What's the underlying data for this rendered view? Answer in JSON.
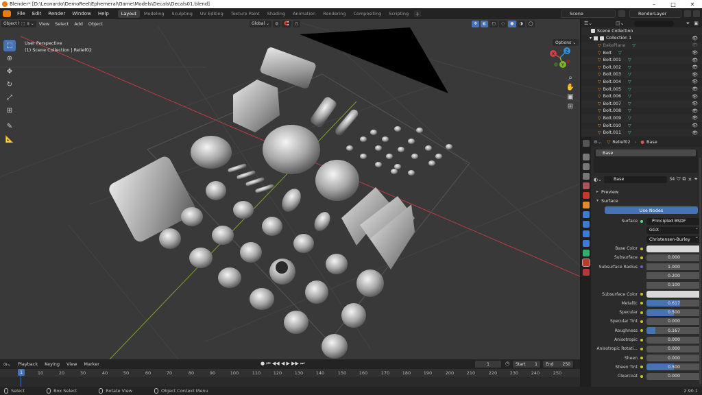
{
  "window": {
    "title": "Blender* [D:\\Leonardo\\DemoReel\\Ephemeral\\Game\\Models\\Decals\\Decals01.blend]",
    "controls": [
      "–",
      "□",
      "✕"
    ]
  },
  "topbar": {
    "menus": [
      "File",
      "Edit",
      "Render",
      "Window",
      "Help"
    ],
    "workspaces": [
      "Layout",
      "Modeling",
      "Sculpting",
      "UV Editing",
      "Texture Paint",
      "Shading",
      "Animation",
      "Rendering",
      "Compositing",
      "Scripting"
    ],
    "active_workspace": "Layout",
    "add_tab": "+",
    "scene": "Scene",
    "view_layer": "RenderLayer"
  },
  "viewport": {
    "mode": "Object Mode",
    "menus": [
      "View",
      "Select",
      "Add",
      "Object"
    ],
    "orientation": "Global",
    "options": "Options",
    "info_line1": "User Perspective",
    "info_line2": "(1) Scene Collection | Relief02",
    "tools": [
      "select-box",
      "cursor",
      "move",
      "rotate",
      "scale",
      "transform",
      "annotate",
      "measure"
    ],
    "gizmo_axes": [
      "X",
      "Y",
      "Z"
    ]
  },
  "timeline": {
    "menus": [
      "Playback",
      "Keying",
      "View",
      "Marker"
    ],
    "current_frame": "1",
    "start_label": "Start",
    "start": "1",
    "end_label": "End",
    "end": "250",
    "ruler": [
      "0",
      "10",
      "20",
      "30",
      "40",
      "50",
      "60",
      "70",
      "80",
      "90",
      "100",
      "110",
      "120",
      "130",
      "140",
      "150",
      "160",
      "170",
      "180",
      "190",
      "200",
      "210",
      "220",
      "230",
      "240",
      "250"
    ],
    "playhead": "1"
  },
  "statusbar": {
    "select": "Select",
    "box_select": "Box Select",
    "rotate_view": "Rotate View",
    "context_menu": "Object Context Menu",
    "version": "2.90.1"
  },
  "outliner": {
    "root": "Scene Collection",
    "collection": "Collection 1",
    "items": [
      "BakePlane",
      "Bolt",
      "Bolt.001",
      "Bolt.002",
      "Bolt.003",
      "Bolt.004",
      "Bolt.005",
      "Bolt.006",
      "Bolt.007",
      "Bolt.008",
      "Bolt.009",
      "Bolt.010",
      "Bolt.011"
    ]
  },
  "properties": {
    "breadcrumb_object": "Relief02",
    "breadcrumb_material": "Base",
    "slot": "Base",
    "material_name": "Base",
    "material_users": "34",
    "sections": {
      "preview": "Preview",
      "surface": "Surface"
    },
    "use_nodes": "Use Nodes",
    "surface_label": "Surface",
    "surface_value": "Principled BSDF",
    "distribution": "GGX",
    "subsurface_method": "Christensen-Burley",
    "rows": [
      {
        "label": "Base Color",
        "value": "",
        "kind": "color"
      },
      {
        "label": "Subsurface",
        "value": "0.000",
        "kind": "num",
        "fill": 0
      },
      {
        "label": "Subsurface Radius",
        "value": "1.000",
        "kind": "vec"
      },
      {
        "label": "",
        "value": "0.200",
        "kind": "vec"
      },
      {
        "label": "",
        "value": "0.100",
        "kind": "vec"
      },
      {
        "label": "Subsurface Color",
        "value": "",
        "kind": "color"
      },
      {
        "label": "Metallic",
        "value": "0.617",
        "kind": "num",
        "fill": 0.617
      },
      {
        "label": "Specular",
        "value": "0.500",
        "kind": "num",
        "fill": 0.5
      },
      {
        "label": "Specular Tint",
        "value": "0.000",
        "kind": "num",
        "fill": 0
      },
      {
        "label": "Roughness",
        "value": "0.167",
        "kind": "num",
        "fill": 0.167
      },
      {
        "label": "Anisotropic",
        "value": "0.000",
        "kind": "num",
        "fill": 0
      },
      {
        "label": "Anisotropic Rotati...",
        "value": "0.000",
        "kind": "num",
        "fill": 0
      },
      {
        "label": "Sheen",
        "value": "0.000",
        "kind": "num",
        "fill": 0
      },
      {
        "label": "Sheen Tint",
        "value": "0.500",
        "kind": "num",
        "fill": 0.5
      },
      {
        "label": "Clearcoat",
        "value": "0.000",
        "kind": "num",
        "fill": 0
      }
    ]
  },
  "colors": {
    "accent": "#4772b3",
    "orange": "#e87d0d",
    "viewport_bg": "#393939",
    "x_axis": "#c4333f",
    "y_axis": "#7cab2c"
  }
}
